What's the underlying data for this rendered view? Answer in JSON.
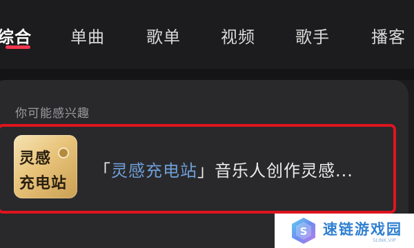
{
  "tabs": [
    {
      "label": "综合",
      "active": true
    },
    {
      "label": "单曲",
      "active": false
    },
    {
      "label": "歌单",
      "active": false
    },
    {
      "label": "视频",
      "active": false
    },
    {
      "label": "歌手",
      "active": false
    },
    {
      "label": "播客",
      "active": false
    }
  ],
  "section": {
    "title": "你可能感兴趣"
  },
  "suggestion": {
    "logo_line1": "灵感",
    "logo_line2": "充电站",
    "open_bracket": "「",
    "keyword": "灵感充电站",
    "close_bracket": "」",
    "description": "音乐人创作灵感..."
  },
  "watermark": {
    "name": "速链游戏园",
    "sub": "SLINK.VIP",
    "logo_text": "S"
  },
  "colors": {
    "accent": "#f2384f",
    "highlight_border": "#e0141e",
    "keyword": "#6f9fd8",
    "background": "#1b1b1d",
    "card": "#29292c",
    "watermark_blue": "#2f7fd1"
  },
  "icons": {
    "badge": "music-badge-icon",
    "watermark_logo": "slink-logo-icon"
  }
}
